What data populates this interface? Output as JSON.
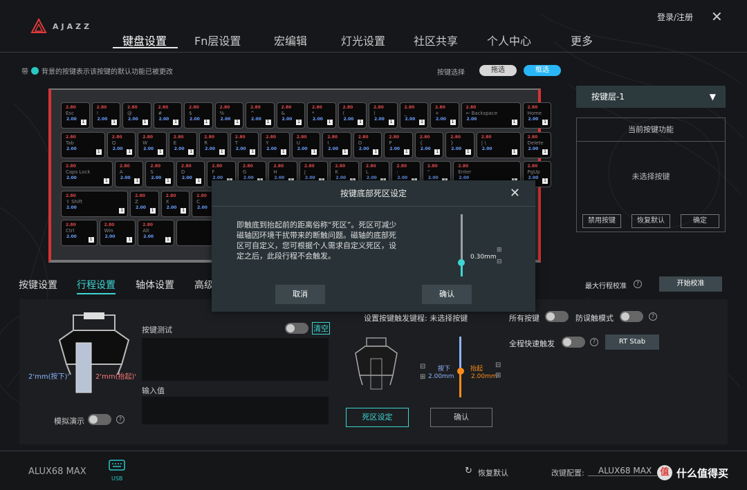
{
  "header": {
    "logo_text": "AJAZZ",
    "tabs": [
      "键盘设置",
      "Fn层设置",
      "宏编辑",
      "灯光设置",
      "社区共享",
      "个人中心",
      "更多"
    ],
    "login": "登录/注册",
    "close": "✕"
  },
  "notice": {
    "prefix": "带",
    "text": "背景的按键表示该按键的默认功能已被更改"
  },
  "key_select": {
    "label": "按键选择",
    "drag": "拖选",
    "box": "框选"
  },
  "keyboard": {
    "rows": [
      {
        "keys": [
          {
            "r": "2.80",
            "g": "Esc",
            "b": "2.00"
          },
          {
            "r": "2.80",
            "g": "!",
            "b": "2.00"
          },
          {
            "r": "2.80",
            "g": "@",
            "b": "2.00"
          },
          {
            "r": "2.80",
            "g": "#",
            "b": "2.00"
          },
          {
            "r": "2.80",
            "g": "$",
            "b": "2.00"
          },
          {
            "r": "2.80",
            "g": "%",
            "b": "2.00"
          },
          {
            "r": "2.80",
            "g": "^",
            "b": "2.00"
          },
          {
            "r": "2.80",
            "g": "&",
            "b": "2.00"
          },
          {
            "r": "2.80",
            "g": "*",
            "b": "2.00"
          },
          {
            "r": "2.80",
            "g": "(",
            "b": "2.00"
          },
          {
            "r": "2.80",
            "g": ")",
            "b": "2.00"
          },
          {
            "r": "2.80",
            "g": "_",
            "b": "2.00"
          },
          {
            "r": "2.80",
            "g": "+",
            "b": "2.00"
          },
          {
            "r": "2.80",
            "g": "← Backspace",
            "b": "2.00"
          },
          {
            "r": "2.80",
            "g": "Home",
            "b": "2.00"
          }
        ]
      },
      {
        "keys": [
          {
            "r": "2.80",
            "g": "Tab",
            "b": "2.00"
          },
          {
            "r": "2.80",
            "g": "Q",
            "b": "2.00"
          },
          {
            "r": "2.80",
            "g": "W",
            "b": "2.00"
          },
          {
            "r": "2.80",
            "g": "E",
            "b": "2.00"
          },
          {
            "r": "2.80",
            "g": "R",
            "b": "2.00"
          },
          {
            "r": "2.80",
            "g": "T",
            "b": "2.00"
          },
          {
            "r": "2.80",
            "g": "Y",
            "b": "2.00"
          },
          {
            "r": "2.80",
            "g": "U",
            "b": "2.00"
          },
          {
            "r": "2.80",
            "g": "I",
            "b": "2.00"
          },
          {
            "r": "2.80",
            "g": "O",
            "b": "2.00"
          },
          {
            "r": "2.80",
            "g": "P",
            "b": "2.00"
          },
          {
            "r": "2.80",
            "g": "{",
            "b": "2.00"
          },
          {
            "r": "2.80",
            "g": "}",
            "b": "2.00"
          },
          {
            "r": "2.80",
            "g": "|  \\",
            "b": "2.00"
          },
          {
            "r": "2.80",
            "g": "Delete",
            "b": "2.00"
          }
        ]
      },
      {
        "keys": [
          {
            "r": "2.80",
            "g": "Caps Lock",
            "b": "2.00"
          },
          {
            "r": "2.80",
            "g": "A",
            "b": "2.00"
          },
          {
            "r": "2.80",
            "g": "S",
            "b": "2.00"
          },
          {
            "r": "2.80",
            "g": "D",
            "b": "2.00"
          },
          {
            "r": "2.80",
            "g": "F",
            "b": "2.00"
          },
          {
            "r": "2.80",
            "g": "G",
            "b": "2.00"
          },
          {
            "r": "2.80",
            "g": "H",
            "b": "2.00"
          },
          {
            "r": "2.80",
            "g": "J",
            "b": "2.00"
          },
          {
            "r": "2.80",
            "g": "K",
            "b": "2.00"
          },
          {
            "r": "2.80",
            "g": "L",
            "b": "2.00"
          },
          {
            "r": "2.80",
            "g": ":",
            "b": "2.00"
          },
          {
            "r": "2.80",
            "g": "\"",
            "b": "2.00"
          },
          {
            "r": "2.80",
            "g": "Enter",
            "b": "2.00"
          },
          {
            "r": "2.80",
            "g": "PgUp",
            "b": "2.00"
          }
        ]
      },
      {
        "keys": [
          {
            "r": "2.80",
            "g": "⇧ Shift",
            "b": "2.00"
          },
          {
            "r": "2.80",
            "g": "Z",
            "b": "2.00"
          },
          {
            "r": "2.80",
            "g": "X",
            "b": "2.00"
          },
          {
            "r": "2.80",
            "g": "C",
            "b": "2.00"
          }
        ]
      },
      {
        "keys": [
          {
            "r": "2.80",
            "g": "Ctrl",
            "b": "2.00"
          },
          {
            "r": "2.80",
            "g": "Win",
            "b": "2.00"
          },
          {
            "r": "2.80",
            "g": "Alt",
            "b": "2.00"
          },
          {
            "r": "",
            "g": "",
            "b": ""
          }
        ]
      }
    ]
  },
  "layer_panel": {
    "dropdown": "按键层-1",
    "title": "当前按键功能",
    "empty": "未选择按键",
    "btn_disable": "禁用按键",
    "btn_restore": "恢复默认",
    "btn_confirm": "确定"
  },
  "subtabs": [
    "按键设置",
    "行程设置",
    "轴体设置",
    "高级"
  ],
  "calibrate": {
    "label": "最大行程校准",
    "btn": "开始校准"
  },
  "left_panel": {
    "press_label": "2'mm(按下)'",
    "release_label": "2'mm(抬起)'",
    "key_test": "按键测试",
    "clear": "清空",
    "input_value": "输入值",
    "demo": "模拟演示"
  },
  "trigger": {
    "title": "设置按键触发键程: 未选择按键",
    "press": "按下",
    "press_val": "2.00mm",
    "release": "抬起",
    "release_val": "2.00mm",
    "deadzone_btn": "死区设定",
    "confirm_btn": "确认"
  },
  "right_opts": {
    "all_keys": "所有按键",
    "anti_mis": "防误触模式",
    "full_rt": "全程快速触发",
    "rt_stab": "RT Stab"
  },
  "modal": {
    "title": "按键底部死区设定",
    "body": "即触底到抬起前的距离俗称“死区”。死区可减少磁轴因环境干扰带来的断触问题。磁轴的底部死区可自定义，您可根据个人需求自定义死区，设定之后，此段行程不会触发。",
    "value": "0.30mm",
    "cancel": "取消",
    "confirm": "确认",
    "slider_value_fraction": 0.22
  },
  "footer": {
    "device": "ALUX68 MAX",
    "usb": "USB",
    "restore": "恢复默认",
    "config_label": "改键配置:",
    "config_value": "ALUX68 MAX",
    "watermark": "什么值得买"
  },
  "colors": {
    "accent": "#29c6c4",
    "red": "#d63434",
    "orange": "#ff8c1a",
    "blue": "#6aa0ff"
  }
}
